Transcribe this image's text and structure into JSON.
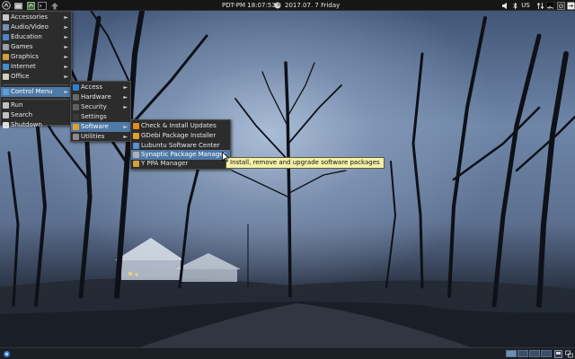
{
  "top_panel": {
    "clock": "PDT-PM 18:07:53",
    "date": "2017.07. 7 Friday",
    "keyboard_layout": "US"
  },
  "main_menu": {
    "items": [
      {
        "label": "Accessories",
        "icon": "accessories-icon",
        "color": "#c8c8c8",
        "submenu": true
      },
      {
        "label": "Audio/Video",
        "icon": "audio-video-icon",
        "color": "#7a8fb0",
        "submenu": true
      },
      {
        "label": "Education",
        "icon": "education-icon",
        "color": "#4a86c9",
        "submenu": true
      },
      {
        "label": "Games",
        "icon": "games-icon",
        "color": "#9aa0a8",
        "submenu": true
      },
      {
        "label": "Graphics",
        "icon": "graphics-icon",
        "color": "#d69c3a",
        "submenu": true
      },
      {
        "label": "Internet",
        "icon": "internet-icon",
        "color": "#3f8fd0",
        "submenu": true
      },
      {
        "label": "Office",
        "icon": "office-icon",
        "color": "#d0d0c0",
        "submenu": true
      },
      {
        "label": "Control Menu",
        "icon": "control-menu-icon",
        "color": "#5aa0d8",
        "submenu": true
      },
      {
        "label": "Run",
        "icon": "run-icon",
        "color": "#c0c0c0",
        "submenu": false
      },
      {
        "label": "Search",
        "icon": "search-icon",
        "color": "#c0c0c0",
        "submenu": false
      },
      {
        "label": "Shutdown",
        "icon": "shutdown-icon",
        "color": "#e0e0e0",
        "submenu": false
      }
    ]
  },
  "control_menu": {
    "items": [
      {
        "label": "Access",
        "icon": "access-icon",
        "color": "#2e7fd0",
        "submenu": true
      },
      {
        "label": "Hardware",
        "icon": "hardware-icon",
        "color": "#6a6a6a",
        "submenu": true
      },
      {
        "label": "Security",
        "icon": "security-icon",
        "color": "#5f5f5f",
        "submenu": true
      },
      {
        "label": "Settings",
        "icon": "settings-icon",
        "color": "#3a3a3a",
        "submenu": false
      },
      {
        "label": "Software",
        "icon": "software-icon",
        "color": "#e0a030",
        "submenu": true
      },
      {
        "label": "Utilities",
        "icon": "utilities-icon",
        "color": "#8a8a8a",
        "submenu": true
      }
    ]
  },
  "software_menu": {
    "items": [
      {
        "label": "Check & Install Updates",
        "icon": "updates-icon",
        "color": "#e08a20"
      },
      {
        "label": "GDebi Package Installer",
        "icon": "gdebi-icon",
        "color": "#e0a030"
      },
      {
        "label": "Lubuntu Software Center",
        "icon": "software-center-icon",
        "color": "#5a8fd0"
      },
      {
        "label": "Synaptic Package Manager",
        "icon": "synaptic-icon",
        "color": "#b0b0b0"
      },
      {
        "label": "Y PPA Manager",
        "icon": "ppa-manager-icon",
        "color": "#d0a040"
      }
    ]
  },
  "tooltip": "Install, remove and upgrade software packages",
  "colors": {
    "menu_bg": "#2c2c2c",
    "highlight": "#4f79a6",
    "tooltip_bg": "#f5f0a8"
  }
}
